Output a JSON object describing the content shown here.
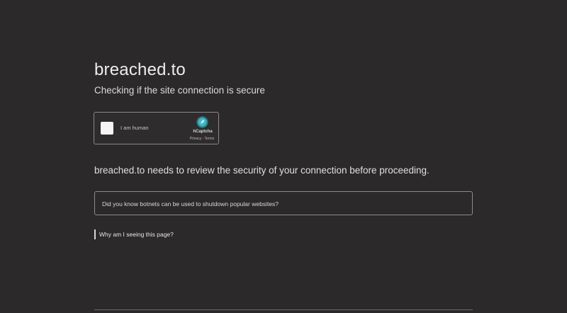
{
  "site": {
    "title": "breached.to",
    "subtitle": "Checking if the site connection is secure"
  },
  "captcha": {
    "label": "I am human",
    "brand": "hCaptcha",
    "links": "Privacy - Terms",
    "logo_icon": "hcaptcha-logo-icon",
    "accent_color": "#3fb8c6"
  },
  "main": {
    "review_text": "breached.to needs to review the security of your connection before proceeding.",
    "tip": "Did you know botnets can be used to shutdown popular websites?",
    "why_link": "Why am I seeing this page?"
  },
  "colors": {
    "background": "#2b292a",
    "text": "#e6e6e6",
    "border": "#8a8a8a"
  }
}
